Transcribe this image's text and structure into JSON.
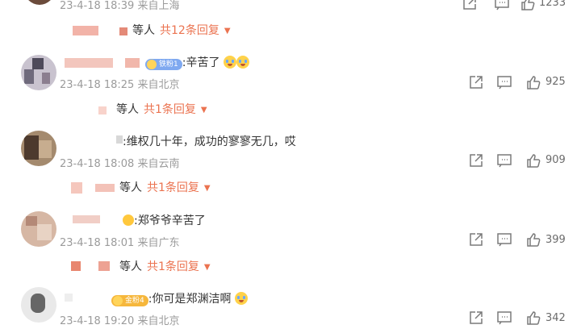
{
  "comments": [
    {
      "time": "23-4-18 18:39",
      "source": "来自上海",
      "likes": "1233",
      "reply": {
        "who": "等人",
        "count": "共12条回复"
      }
    },
    {
      "text": ":辛苦了",
      "badge": "铁粉1",
      "time": "23-4-18 18:25",
      "source": "来自北京",
      "likes": "925",
      "reply": {
        "who": "等人",
        "count": "共1条回复"
      }
    },
    {
      "text": ":维权几十年，成功的寥寥无几，哎",
      "time": "23-4-18 18:08",
      "source": "来自云南",
      "likes": "909",
      "reply": {
        "who": "等人",
        "count": "共1条回复"
      }
    },
    {
      "text": ":郑爷爷辛苦了",
      "time": "23-4-18 18:01",
      "source": "来自广东",
      "likes": "399",
      "reply": {
        "who": "等人",
        "count": "共1条回复"
      }
    },
    {
      "text": ":你可是郑渊洁啊",
      "badge": "金粉4",
      "time": "23-4-18 19:20",
      "source": "来自北京",
      "likes": "342"
    }
  ],
  "colors": {
    "accent": "#eb7350",
    "meta": "#9b9b9b"
  },
  "icons": [
    "share-icon",
    "comment-icon",
    "like-icon",
    "chevron-down-icon"
  ]
}
